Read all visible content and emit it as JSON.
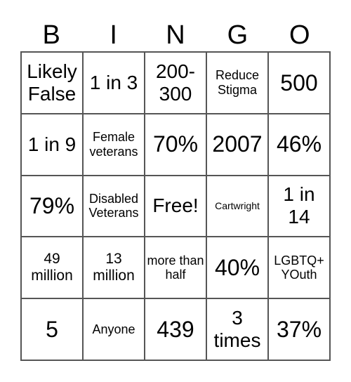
{
  "header": [
    "B",
    "I",
    "N",
    "G",
    "O"
  ],
  "cells": [
    "Likely False",
    "1 in 3",
    "200-300",
    "Reduce Stigma",
    "500",
    "1 in 9",
    "Female veterans",
    "70%",
    "2007",
    "46%",
    "79%",
    "Disabled Veterans",
    "Free!",
    "Cartwright",
    "1 in 14",
    "49 million",
    "13 million",
    "more than half",
    "40%",
    "LGBTQ+ YOuth",
    "5",
    "Anyone",
    "439",
    "3 times",
    "37%"
  ]
}
